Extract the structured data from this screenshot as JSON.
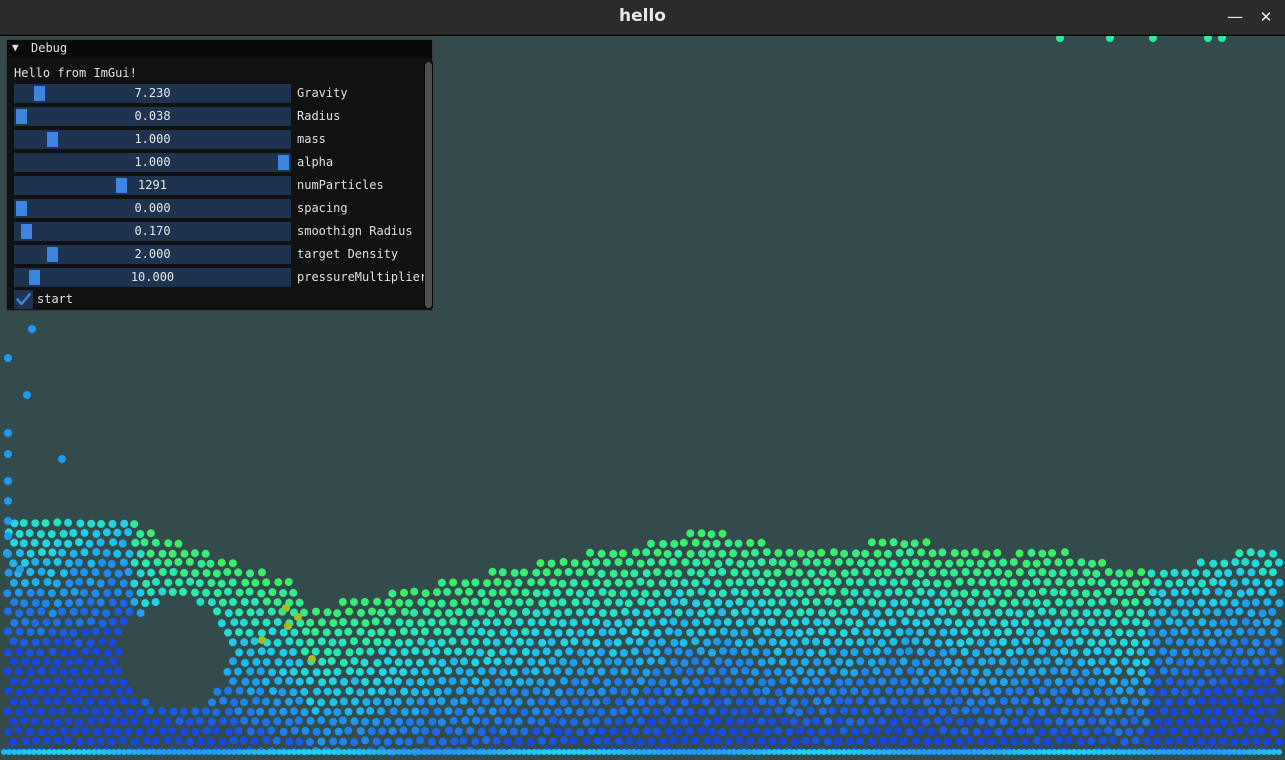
{
  "window": {
    "title": "hello",
    "minimize_icon": "minimize-icon",
    "close_icon": "close-icon",
    "background_color": "#344b4c"
  },
  "debug": {
    "title": "Debug",
    "collapse_icon": "triangle-down-icon",
    "hello_text": "Hello from ImGui!",
    "sliders": [
      {
        "label": "Gravity",
        "value": "7.230",
        "fraction": 0.07
      },
      {
        "label": "Radius",
        "value": "0.038",
        "fraction": 0.0
      },
      {
        "label": "mass",
        "value": "1.000",
        "fraction": 0.12
      },
      {
        "label": "alpha",
        "value": "1.000",
        "fraction": 1.0
      },
      {
        "label": "numParticles",
        "value": "1291",
        "fraction": 0.38
      },
      {
        "label": "spacing",
        "value": "0.000",
        "fraction": 0.0
      },
      {
        "label": "smoothign Radius",
        "value": "0.170",
        "fraction": 0.02
      },
      {
        "label": "target Density",
        "value": "2.000",
        "fraction": 0.12
      },
      {
        "label": "pressureMultiplier",
        "value": "10.000",
        "fraction": 0.05
      }
    ],
    "checkbox": {
      "label": "start",
      "checked": true,
      "icon": "checkmark-icon"
    },
    "accent_color": "#3d85e0",
    "frame_color": "#1d3350"
  }
}
